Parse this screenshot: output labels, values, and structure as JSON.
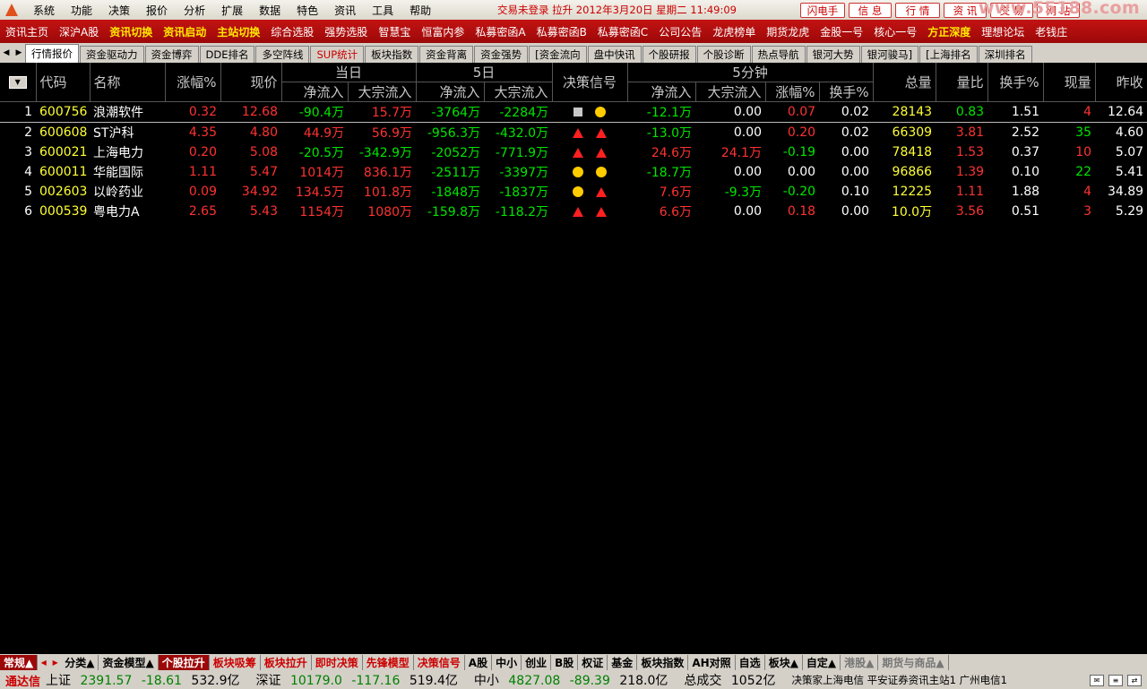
{
  "menu": {
    "items": [
      "系统",
      "功能",
      "决策",
      "报价",
      "分析",
      "扩展",
      "数据",
      "特色",
      "资讯",
      "工具",
      "帮助"
    ],
    "status": "交易未登录 拉升 2012年3月20日 星期二 11:49:09",
    "buttons": [
      "闪电手",
      "信 息",
      "行 情",
      "资 讯",
      "交 易",
      "网 站"
    ],
    "watermark": "www.55188.com"
  },
  "toolbar": [
    {
      "label": "资讯主页",
      "hl": false
    },
    {
      "label": "深沪A股",
      "hl": false
    },
    {
      "label": "资讯切换",
      "hl": true
    },
    {
      "label": "资讯启动",
      "hl": true
    },
    {
      "label": "主站切换",
      "hl": true
    },
    {
      "label": "综合选股",
      "hl": false
    },
    {
      "label": "强势选股",
      "hl": false
    },
    {
      "label": "智慧宝",
      "hl": false
    },
    {
      "label": "恒富内参",
      "hl": false
    },
    {
      "label": "私募密函A",
      "hl": false
    },
    {
      "label": "私募密函B",
      "hl": false
    },
    {
      "label": "私募密函C",
      "hl": false
    },
    {
      "label": "公司公告",
      "hl": false
    },
    {
      "label": "龙虎榜单",
      "hl": false
    },
    {
      "label": "期货龙虎",
      "hl": false
    },
    {
      "label": "金股一号",
      "hl": false
    },
    {
      "label": "核心一号",
      "hl": false
    },
    {
      "label": "方正深度",
      "hl": true
    },
    {
      "label": "理想论坛",
      "hl": false
    },
    {
      "label": "老钱庄",
      "hl": false
    }
  ],
  "tabs": [
    {
      "label": "行情报价",
      "active": true,
      "red": false
    },
    {
      "label": "资金驱动力",
      "active": false,
      "red": false
    },
    {
      "label": "资金博弈",
      "active": false,
      "red": false
    },
    {
      "label": "DDE排名",
      "active": false,
      "red": false
    },
    {
      "label": "多空阵线",
      "active": false,
      "red": false
    },
    {
      "label": "SUP统计",
      "active": false,
      "red": true
    },
    {
      "label": "板块指数",
      "active": false,
      "red": false
    },
    {
      "label": "资金背离",
      "active": false,
      "red": false
    },
    {
      "label": "资金强势",
      "active": false,
      "red": false
    },
    {
      "label": "[资金流向",
      "active": false,
      "red": false
    },
    {
      "label": "盘中快讯",
      "active": false,
      "red": false
    },
    {
      "label": "个股研报",
      "active": false,
      "red": false
    },
    {
      "label": "个股诊断",
      "active": false,
      "red": false
    },
    {
      "label": "热点导航",
      "active": false,
      "red": false
    },
    {
      "label": "银河大势",
      "active": false,
      "red": false
    },
    {
      "label": "银河骏马]",
      "active": false,
      "red": false
    },
    {
      "label": "[上海排名",
      "active": false,
      "red": false
    },
    {
      "label": "深圳排名",
      "active": false,
      "red": false
    }
  ],
  "table": {
    "group_headers": {
      "day": "当日",
      "five_day": "5日",
      "signal": "决策信号",
      "five_min": "5分钟"
    },
    "headers": {
      "code": "代码",
      "name": "名称",
      "change": "涨幅%",
      "price": "现价",
      "day_net": "净流入",
      "day_block": "大宗流入",
      "d5_net": "净流入",
      "d5_block": "大宗流入",
      "m5_net": "净流入",
      "m5_block": "大宗流入",
      "m5_change": "涨幅%",
      "m5_turnover": "换手%",
      "volume": "总量",
      "vol_ratio": "量比",
      "turnover": "换手%",
      "cur_vol": "现量",
      "prev_close": "昨收"
    },
    "rows": [
      {
        "idx": "1",
        "code": "600756",
        "name": "浪潮软件",
        "change": "0.32",
        "price": "12.68",
        "day_net": "-90.4万",
        "day_block": "15.7万",
        "d5_net": "-3764万",
        "d5_block": "-2284万",
        "signals": [
          "square",
          "circle"
        ],
        "m5_net": "-12.1万",
        "m5_block": "0.00",
        "m5_change": "0.07",
        "m5_turnover": "0.02",
        "volume": "28143",
        "vol_ratio": "0.83",
        "turnover": "1.51",
        "cur_vol": "4",
        "prev_close": "12.64"
      },
      {
        "idx": "2",
        "code": "600608",
        "name": "ST沪科",
        "change": "4.35",
        "price": "4.80",
        "day_net": "44.9万",
        "day_block": "56.9万",
        "d5_net": "-956.3万",
        "d5_block": "-432.0万",
        "signals": [
          "triangle",
          "triangle"
        ],
        "m5_net": "-13.0万",
        "m5_block": "0.00",
        "m5_change": "0.20",
        "m5_turnover": "0.02",
        "volume": "66309",
        "vol_ratio": "3.81",
        "turnover": "2.52",
        "cur_vol": "35",
        "prev_close": "4.60"
      },
      {
        "idx": "3",
        "code": "600021",
        "name": "上海电力",
        "change": "0.20",
        "price": "5.08",
        "day_net": "-20.5万",
        "day_block": "-342.9万",
        "d5_net": "-2052万",
        "d5_block": "-771.9万",
        "signals": [
          "triangle",
          "triangle"
        ],
        "m5_net": "24.6万",
        "m5_block": "24.1万",
        "m5_change": "-0.19",
        "m5_turnover": "0.00",
        "volume": "78418",
        "vol_ratio": "1.53",
        "turnover": "0.37",
        "cur_vol": "10",
        "prev_close": "5.07"
      },
      {
        "idx": "4",
        "code": "600011",
        "name": "华能国际",
        "change": "1.11",
        "price": "5.47",
        "day_net": "1014万",
        "day_block": "836.1万",
        "d5_net": "-2511万",
        "d5_block": "-3397万",
        "signals": [
          "circle",
          "circle"
        ],
        "m5_net": "-18.7万",
        "m5_block": "0.00",
        "m5_change": "0.00",
        "m5_turnover": "0.00",
        "volume": "96866",
        "vol_ratio": "1.39",
        "turnover": "0.10",
        "cur_vol": "22",
        "prev_close": "5.41"
      },
      {
        "idx": "5",
        "code": "002603",
        "name": "以岭药业",
        "change": "0.09",
        "price": "34.92",
        "day_net": "134.5万",
        "day_block": "101.8万",
        "d5_net": "-1848万",
        "d5_block": "-1837万",
        "signals": [
          "circle",
          "triangle"
        ],
        "m5_net": "7.6万",
        "m5_block": "-9.3万",
        "m5_change": "-0.20",
        "m5_turnover": "0.10",
        "volume": "12225",
        "vol_ratio": "1.11",
        "turnover": "1.88",
        "cur_vol": "4",
        "prev_close": "34.89"
      },
      {
        "idx": "6",
        "code": "000539",
        "name": "粤电力A",
        "change": "2.65",
        "price": "5.43",
        "day_net": "1154万",
        "day_block": "1080万",
        "d5_net": "-159.8万",
        "d5_block": "-118.2万",
        "signals": [
          "triangle",
          "triangle"
        ],
        "m5_net": "6.6万",
        "m5_block": "0.00",
        "m5_change": "0.18",
        "m5_turnover": "0.00",
        "volume": "10.0万",
        "vol_ratio": "3.56",
        "turnover": "0.51",
        "cur_vol": "3",
        "prev_close": "5.29"
      }
    ]
  },
  "categories": [
    {
      "label": "常规▲",
      "style": "first"
    },
    {
      "label": "分类▲",
      "style": ""
    },
    {
      "label": "资金模型▲",
      "style": ""
    },
    {
      "label": "个股拉升",
      "style": "active"
    },
    {
      "label": "板块吸筹",
      "style": "red"
    },
    {
      "label": "板块拉升",
      "style": "red"
    },
    {
      "label": "即时决策",
      "style": "red"
    },
    {
      "label": "先锋模型",
      "style": "red"
    },
    {
      "label": "决策信号",
      "style": "red"
    },
    {
      "label": "A股",
      "style": ""
    },
    {
      "label": "中小",
      "style": ""
    },
    {
      "label": "创业",
      "style": ""
    },
    {
      "label": "B股",
      "style": ""
    },
    {
      "label": "权证",
      "style": ""
    },
    {
      "label": "基金",
      "style": ""
    },
    {
      "label": "板块指数",
      "style": ""
    },
    {
      "label": "AH对照",
      "style": ""
    },
    {
      "label": "自选",
      "style": ""
    },
    {
      "label": "板块▲",
      "style": ""
    },
    {
      "label": "自定▲",
      "style": ""
    },
    {
      "label": "港股▲",
      "style": "gray"
    },
    {
      "label": "期货与商品▲",
      "style": "gray"
    }
  ],
  "statusbar": {
    "brand": "通达信",
    "sh": {
      "name": "上证",
      "value": "2391.57",
      "change": "-18.61",
      "amount": "532.9亿"
    },
    "sz": {
      "name": "深证",
      "value": "10179.0",
      "change": "-117.16",
      "amount": "519.4亿"
    },
    "zx": {
      "name": "中小",
      "value": "4827.08",
      "change": "-89.39",
      "amount": "218.0亿"
    },
    "total_label": "总成交",
    "total": "1052亿",
    "servers": "决策家上海电信 平安证券资讯主站1 广州电信1"
  }
}
